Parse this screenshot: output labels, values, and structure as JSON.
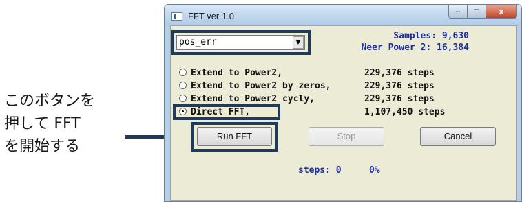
{
  "annotation": {
    "lines": [
      "このボタンを",
      "押して FFT",
      "を開始する"
    ]
  },
  "window": {
    "title": "FFT ver 1.0",
    "controls": {
      "minimize": "–",
      "maximize": "□",
      "close": "x"
    }
  },
  "combo": {
    "value": "pos_err",
    "arrow": "▼"
  },
  "info": {
    "samples": "Samples: 9,630",
    "neer": "Neer Power 2: 16,384"
  },
  "options": [
    {
      "label": "Extend to Power2,",
      "steps": "229,376 steps",
      "selected": false
    },
    {
      "label": "Extend to Power2 by zeros,",
      "steps": "229,376 steps",
      "selected": false
    },
    {
      "label": "Extend to Power2 cycly,",
      "steps": "229,376 steps",
      "selected": false
    },
    {
      "label": "Direct FFT,",
      "steps": "1,107,450 steps",
      "selected": true
    }
  ],
  "buttons": {
    "run": "Run FFT",
    "stop": "Stop",
    "cancel": "Cancel"
  },
  "progress": {
    "steps": "steps: 0",
    "percent": "0%"
  },
  "colors": {
    "highlight": "#1f3a5b",
    "info_text": "#1c2fa0",
    "client_bg": "#ecebd6"
  }
}
